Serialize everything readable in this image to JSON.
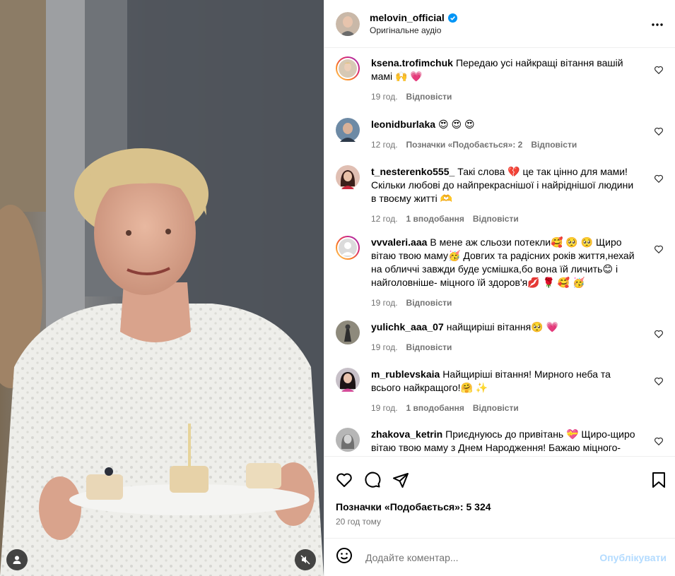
{
  "post": {
    "username": "melovin_official",
    "audio": "Оригінальне аудіо",
    "likes_text": "Позначки «Подобається»: 5 324",
    "posted_ago": "20 год тому"
  },
  "comments": [
    {
      "user": "ksena.trofimchuk",
      "text": "Передаю усі найкращі вітання вашій мамі 🙌 💗",
      "time": "19 год.",
      "likes": "",
      "reply": "Відповісти"
    },
    {
      "user": "leonidburlaka",
      "text": "😍 😍 😍",
      "time": "12 год.",
      "likes": "Позначки «Подобається»: 2",
      "reply": "Відповісти"
    },
    {
      "user": "t_nesterenko555_",
      "text": "Такі слова 💔 це так цінно для мами! Скільки любові до найпрекраснішої і найріднішої людини в твоєму житті 🫶",
      "time": "12 год.",
      "likes": "1 вподобання",
      "reply": "Відповісти"
    },
    {
      "user": "vvvaleri.aaa",
      "text": "В мене аж сльози потекли🥰 🥺 🥺 Щиро вітаю твою маму🥳 Довгих та радісних років життя,нехай на обличчі завжди буде усмішка,бо вона їй личить😊 і найголовніше- міцного їй здоров'я💋 🌹 🥰 🥳",
      "time": "19 год.",
      "likes": "",
      "reply": "Відповісти"
    },
    {
      "user": "yulichk_aaa_07",
      "text": "найщиріші вітання🥺 💗",
      "time": "19 год.",
      "likes": "",
      "reply": "Відповісти"
    },
    {
      "user": "m_rublevskaia",
      "text": "Найщиріші вітання! Мирного неба та всього найкращого!🤗 ✨",
      "time": "19 год.",
      "likes": "1 вподобання",
      "reply": "Відповісти"
    },
    {
      "user": "zhakova_ketrin",
      "text": "Приєднуюсь до привітань 💝 Щиро-щиро вітаю твою маму з Днем Народження! Бажаю міцного-міцного здоров'я,безліч щастя і незабутніх",
      "time": "",
      "likes": "",
      "reply": ""
    }
  ],
  "composer": {
    "placeholder": "Додайте коментар...",
    "publish_label": "Опублікувати"
  },
  "colors": {
    "verified": "#0095f6",
    "publish_disabled": "#b3dbff",
    "meta": "#737373"
  },
  "icons": [
    "verified-badge-icon",
    "more-options-icon",
    "heart-icon",
    "comment-icon",
    "share-icon",
    "bookmark-icon",
    "emoji-icon",
    "user-tag-icon",
    "mute-icon"
  ]
}
